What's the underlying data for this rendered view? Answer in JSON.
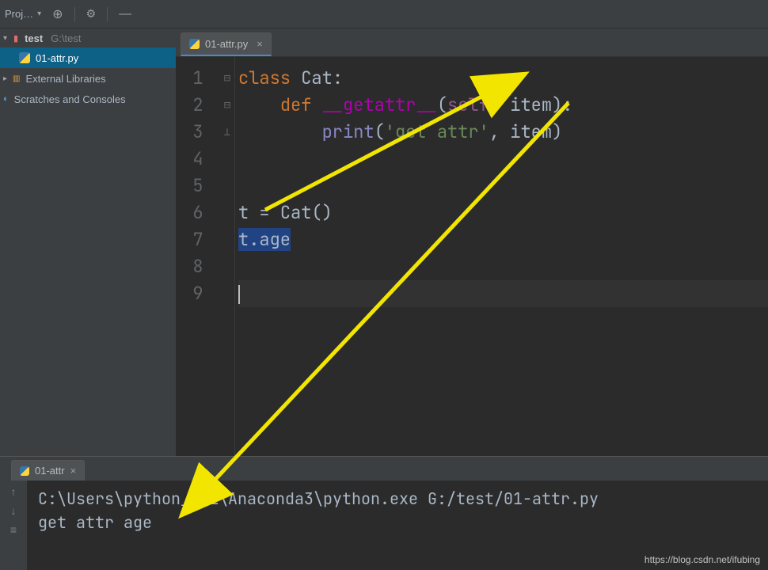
{
  "toolbar": {
    "project_label": "Proj…",
    "settings_tooltip": "Settings"
  },
  "project": {
    "name": "test",
    "path": "G:\\test"
  },
  "tree": {
    "file": "01-attr.py",
    "external_libraries": "External Libraries",
    "scratches": "Scratches and Consoles"
  },
  "editor_tab": {
    "name": "01-attr.py"
  },
  "code": {
    "lines": {
      "1": {
        "kw_class": "class",
        "cls_name": "Cat",
        "colon": ":"
      },
      "2": {
        "kw_def": "def",
        "method": "__getattr__",
        "self": "self",
        "param": "item"
      },
      "3": {
        "builtin": "print",
        "str": "'get attr'",
        "arg": "item"
      },
      "6": {
        "var": "t",
        "eq": " = ",
        "cls": "Cat",
        "call": "()"
      },
      "7": {
        "obj": "t",
        "dot": ".",
        "attr": "age"
      }
    },
    "line_numbers": [
      "1",
      "2",
      "3",
      "4",
      "5",
      "6",
      "7",
      "8",
      "9"
    ]
  },
  "run_tab": {
    "name": "01-attr"
  },
  "console": {
    "line1": "C:\\Users\\python_hui\\Anaconda3\\python.exe G:/test/01-attr.py",
    "line2": "get attr age"
  },
  "watermark": "https://blog.csdn.net/ifubing"
}
